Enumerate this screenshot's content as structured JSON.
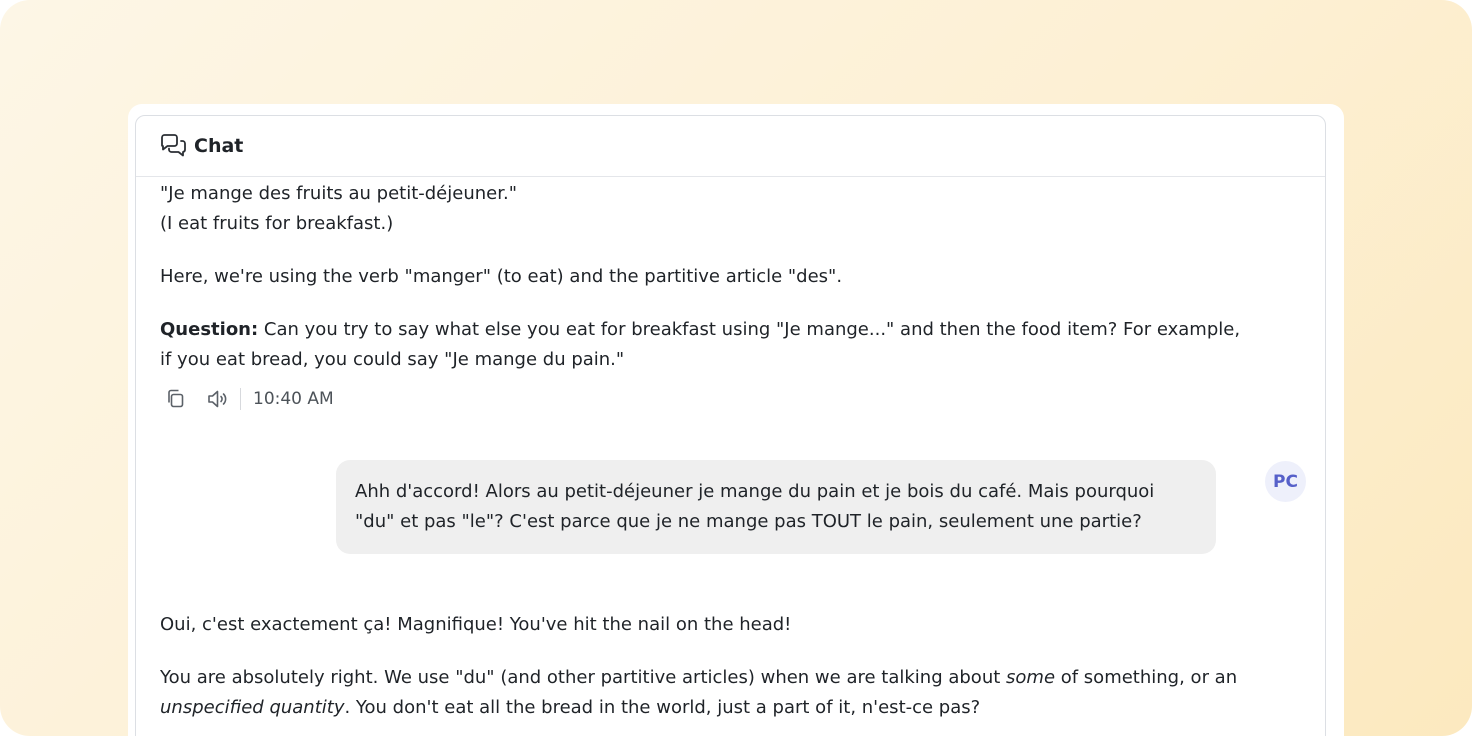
{
  "window": {
    "title": "Chat",
    "icon": "chat-bubbles-icon"
  },
  "messages": [
    {
      "role": "assistant",
      "lines": [
        "\"Je mange des fruits au petit-déjeuner.\"",
        "(I eat fruits for breakfast.)"
      ],
      "paragraph2": "Here, we're using the verb \"manger\" (to eat) and the partitive article \"des\".",
      "question_label": "Question:",
      "question_text": " Can you try to say what else you eat for breakfast using \"Je mange...\" and then the food item? For example, if you eat bread, you could say \"Je mange du pain.\"",
      "time": "10:40 AM",
      "actions": [
        "copy-icon",
        "speaker-icon"
      ]
    },
    {
      "role": "user",
      "avatar": "PC",
      "text": "Ahh d'accord! Alors au petit-déjeuner je mange du pain et je bois du café. Mais pourquoi \"du\" et pas \"le\"? C'est parce que je ne mange pas TOUT le pain, seulement une partie?"
    },
    {
      "role": "assistant",
      "paragraph1": "Oui, c'est exactement ça! Magnifique! You've hit the nail on the head!",
      "p2_a": "You are absolutely right. We use \"du\" (and other partitive articles) when we are talking about ",
      "p2_em1": "some",
      "p2_b": " of something, or an ",
      "p2_em2": "unspecified quantity",
      "p2_c": ". You don't eat all the bread in the world, just a part of it, n'est-ce pas?"
    }
  ],
  "colors": {
    "background_gradient": [
      "#fdf6e6",
      "#fce9bf"
    ],
    "user_bubble": "#efefef",
    "avatar_bg": "#eef0fb",
    "avatar_text": "#5660c9",
    "text": "#1f2328"
  }
}
